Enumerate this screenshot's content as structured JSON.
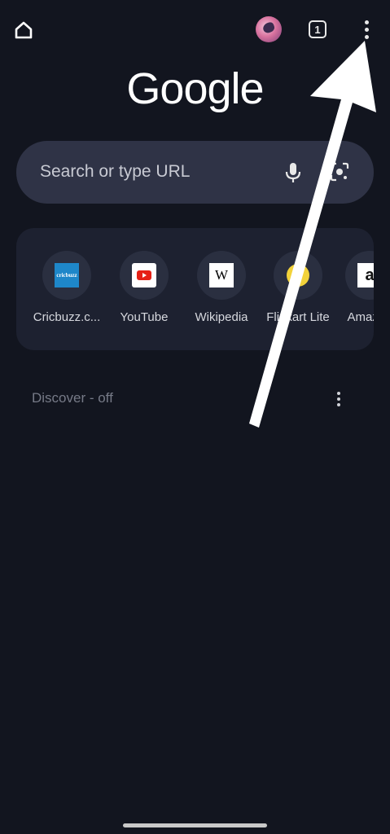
{
  "toolbar": {
    "home_icon": "home-icon",
    "tab_count": "1",
    "menu_icon": "more-vert-icon"
  },
  "logo": {
    "text": "Google"
  },
  "search": {
    "placeholder": "Search or type URL",
    "mic_icon": "mic-icon",
    "lens_icon": "lens-icon"
  },
  "shortcuts": [
    {
      "label": "Cricbuzz.c...",
      "icon": "cricbuzz-icon",
      "icon_text": "cricbuzz"
    },
    {
      "label": "YouTube",
      "icon": "youtube-icon"
    },
    {
      "label": "Wikipedia",
      "icon": "wikipedia-icon",
      "icon_text": "W"
    },
    {
      "label": "Flipkart Lite",
      "icon": "flipkart-icon"
    },
    {
      "label": "Amazon",
      "icon": "amazon-icon",
      "icon_text": "a"
    }
  ],
  "discover": {
    "label": "Discover - off"
  },
  "colors": {
    "background": "#12151f",
    "search_bg": "#2f3346",
    "shortcuts_bg": "#1d2130",
    "arrow": "#ffffff"
  }
}
